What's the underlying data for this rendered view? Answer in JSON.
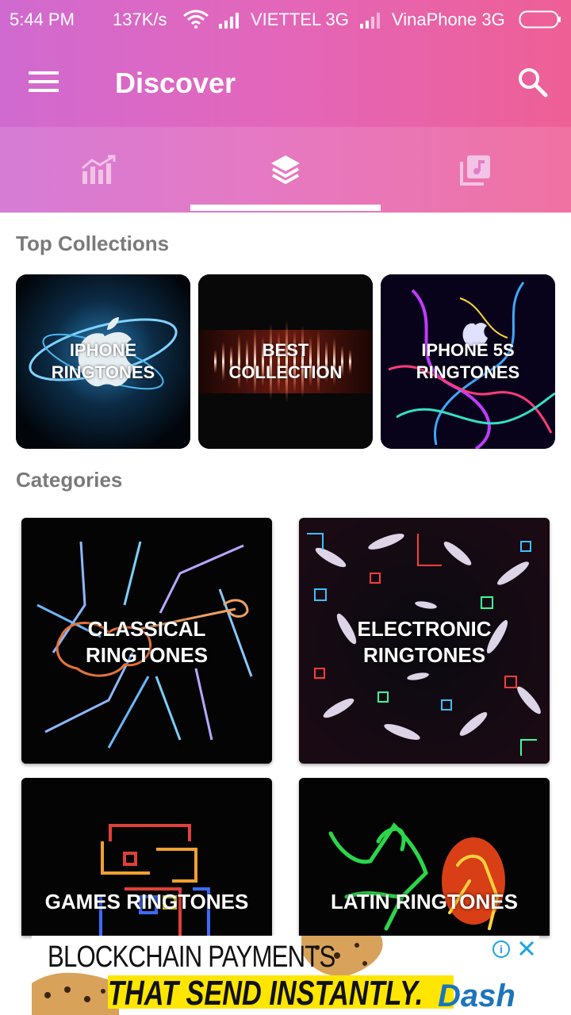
{
  "status_bar": {
    "time": "5:44 PM",
    "speed": "137K/s",
    "carrier1": "VIETTEL 3G",
    "carrier2": "VinaPhone 3G"
  },
  "app_bar": {
    "title": "Discover"
  },
  "tabs": [
    {
      "icon": "trending-chart-icon",
      "selected": false
    },
    {
      "icon": "layers-icon",
      "selected": true
    },
    {
      "icon": "music-library-icon",
      "selected": false
    }
  ],
  "top_collections": {
    "title": "Top Collections",
    "items": [
      {
        "line1": "IPHONE",
        "line2": "RINGTONES"
      },
      {
        "line1": "BEST",
        "line2": "COLLECTION"
      },
      {
        "line1": "IPHONE 5S",
        "line2": "RINGTONES"
      }
    ]
  },
  "categories": {
    "title": "Categories",
    "items": [
      {
        "line1": "CLASSICAL",
        "line2": "RINGTONES"
      },
      {
        "line1": "ELECTRONIC",
        "line2": "RINGTONES"
      },
      {
        "line1": "GAMES RINGTONES",
        "line2": ""
      },
      {
        "line1": "LATIN RINGTONES",
        "line2": ""
      }
    ]
  },
  "ad": {
    "line1": "BLOCKCHAIN PAYMENTS",
    "line2": "THAT SEND INSTANTLY.",
    "brand": "Dash",
    "info": "i"
  },
  "colors": {
    "header_start": "#d06ad0",
    "header_end": "#ee5f95",
    "section_title": "#7a7a7a",
    "ad_accent": "#ffe600",
    "ad_brand": "#1c75bc"
  }
}
